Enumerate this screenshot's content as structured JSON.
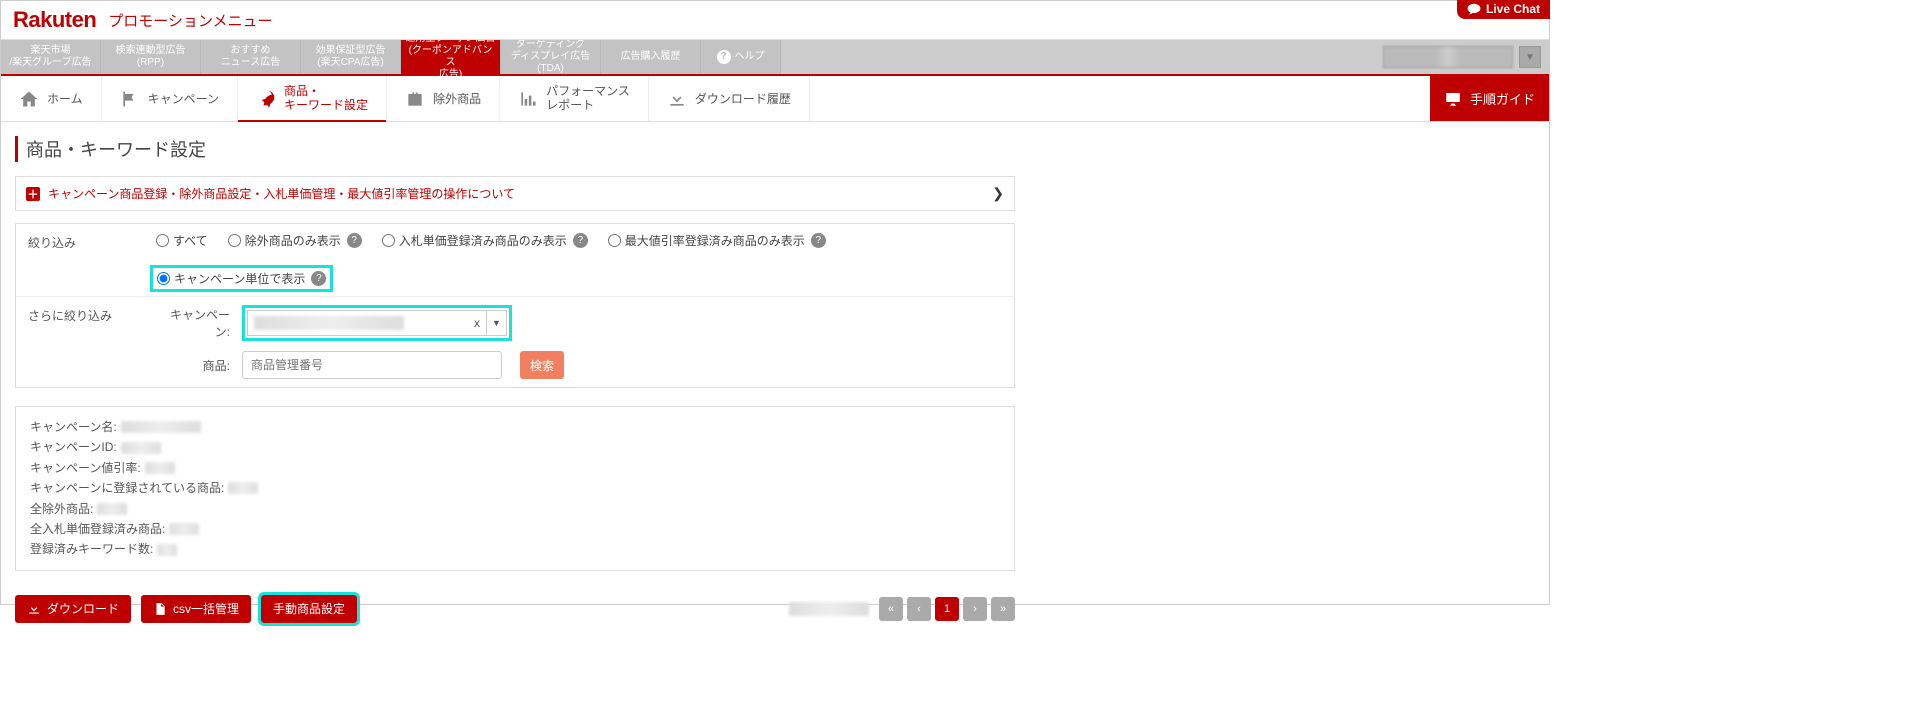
{
  "header": {
    "logo": "Rakuten",
    "title": "プロモーションメニュー",
    "live_chat": "Live Chat"
  },
  "topnav": [
    "楽天市場\n/楽天グループ広告",
    "検索連動型広告\n(RPP)",
    "おすすめ\nニュース広告",
    "効果保証型広告\n(楽天CPA広告)",
    "運用型クーポン広告\n(クーポンアドバンス\n広告)",
    "ターゲティング\nディスプレイ広告\n(TDA)",
    "広告購入履歴",
    "ヘルプ"
  ],
  "topnav_active": 4,
  "subnav": {
    "home": "ホーム",
    "campaign": "キャンペーン",
    "keyword1": "商品・",
    "keyword2": "キーワード設定",
    "excluded": "除外商品",
    "report1": "パフォーマンス",
    "report2": "レポート",
    "history": "ダウンロード履歴",
    "guide": "手順ガイド"
  },
  "page_title": "商品・キーワード設定",
  "accordion": "キャンペーン商品登録・除外商品設定・入札単価管理・最大値引率管理の操作について",
  "filter": {
    "label1": "絞り込み",
    "label2": "さらに絞り込み",
    "opts": {
      "all": "すべて",
      "excluded": "除外商品のみ表示",
      "bid": "入札単価登録済み商品のみ表示",
      "discount": "最大値引率登録済み商品のみ表示",
      "campaign": "キャンペーン単位で表示"
    },
    "campaign_label": "キャンペーン:",
    "product_label": "商品:",
    "product_placeholder": "商品管理番号",
    "search_btn": "検索"
  },
  "info": {
    "k0": "キャンペーン名:",
    "k1": "キャンペーンID:",
    "k2": "キャンペーン値引率:",
    "k3": "キャンペーンに登録されている商品:",
    "k4": "全除外商品:",
    "k5": "全入札単価登録済み商品:",
    "k6": "登録済みキーワード数:"
  },
  "actions": {
    "download": "ダウンロード",
    "csv": "csv一括管理",
    "manual": "手動商品設定"
  },
  "pager": {
    "first": "«",
    "prev": "‹",
    "page": "1",
    "next": "›",
    "last": "»"
  }
}
